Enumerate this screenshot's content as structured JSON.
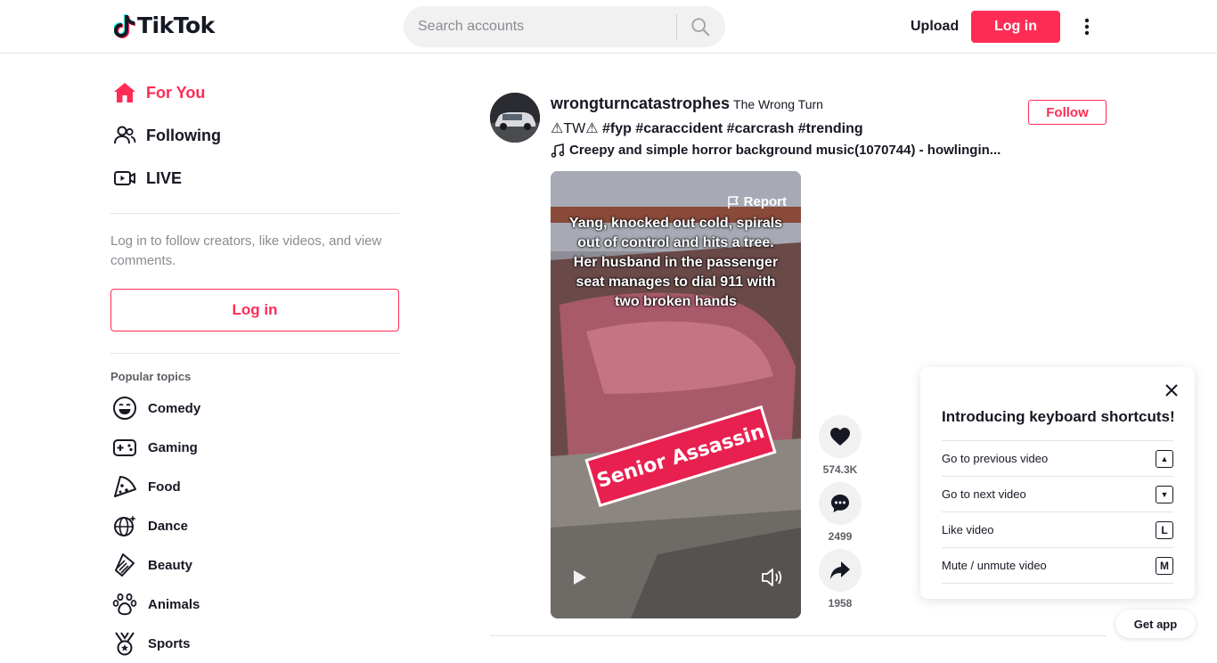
{
  "header": {
    "logo_text": "TikTok",
    "search_placeholder": "Search accounts",
    "upload_label": "Upload",
    "login_label": "Log in"
  },
  "sidebar": {
    "nav": [
      {
        "label": "For You",
        "icon": "home-icon",
        "active": true
      },
      {
        "label": "Following",
        "icon": "users-icon",
        "active": false
      },
      {
        "label": "LIVE",
        "icon": "live-icon",
        "active": false
      }
    ],
    "login_hint": "Log in to follow creators, like videos, and view comments.",
    "login_button": "Log in",
    "topics_title": "Popular topics",
    "topics": [
      {
        "label": "Comedy",
        "icon": "laugh-icon"
      },
      {
        "label": "Gaming",
        "icon": "gamepad-icon"
      },
      {
        "label": "Food",
        "icon": "pizza-icon"
      },
      {
        "label": "Dance",
        "icon": "disco-ball-icon"
      },
      {
        "label": "Beauty",
        "icon": "comb-icon"
      },
      {
        "label": "Animals",
        "icon": "paw-icon"
      },
      {
        "label": "Sports",
        "icon": "medal-icon"
      }
    ]
  },
  "post": {
    "author_id": "wrongturncatastrophes",
    "author_nick": "The Wrong Turn",
    "caption_prefix": "⚠TW⚠",
    "hashtags": [
      "#fyp",
      "#caraccident",
      "#carcrash",
      "#trending"
    ],
    "music": "Creepy and simple horror background music(1070744) - howlingin...",
    "follow_label": "Follow",
    "report_label": "Report",
    "overlay_text": "Yang, knocked out cold, spirals out of control and hits a tree. Her husband in the passenger seat manages to dial 911 with two broken hands",
    "banner_text": "Senior Assassin",
    "likes": "574.3K",
    "comments": "2499",
    "shares": "1958"
  },
  "shortcuts": {
    "title": "Introducing keyboard shortcuts!",
    "items": [
      {
        "label": "Go to previous video",
        "key": "▲"
      },
      {
        "label": "Go to next video",
        "key": "▼"
      },
      {
        "label": "Like video",
        "key": "L"
      },
      {
        "label": "Mute / unmute video",
        "key": "M"
      }
    ]
  },
  "get_app_label": "Get app",
  "colors": {
    "accent": "#fe2c55",
    "text": "#161823",
    "muted": "#8a8b91"
  }
}
